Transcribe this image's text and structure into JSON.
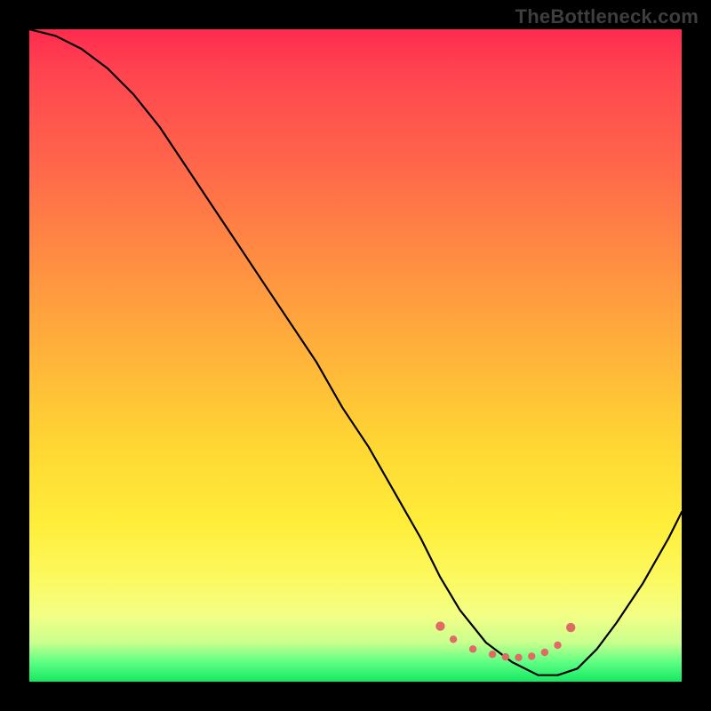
{
  "watermark": "TheBottleneck.com",
  "colors": {
    "frame_bg": "#000000",
    "curve_stroke": "#000000",
    "dot_fill": "#e06a64"
  },
  "chart_data": {
    "type": "line",
    "title": "",
    "xlabel": "",
    "ylabel": "",
    "xlim": [
      0,
      100
    ],
    "ylim": [
      0,
      100
    ],
    "series": [
      {
        "name": "bottleneck-curve",
        "x": [
          0,
          4,
          8,
          12,
          16,
          20,
          24,
          28,
          32,
          36,
          40,
          44,
          48,
          52,
          56,
          60,
          63,
          66,
          70,
          74,
          78,
          81,
          84,
          87,
          90,
          94,
          98,
          100
        ],
        "y": [
          100,
          99,
          97,
          94,
          90,
          85,
          79,
          73,
          67,
          61,
          55,
          49,
          42,
          36,
          29,
          22,
          16,
          11,
          6,
          3,
          1,
          1,
          2,
          5,
          9,
          15,
          22,
          26
        ]
      }
    ],
    "highlight_dots": {
      "x": [
        63,
        65,
        68,
        71,
        73,
        75,
        77,
        79,
        81,
        83
      ],
      "y": [
        8.5,
        6.5,
        5.0,
        4.2,
        3.8,
        3.7,
        3.9,
        4.5,
        5.6,
        8.3
      ]
    }
  }
}
